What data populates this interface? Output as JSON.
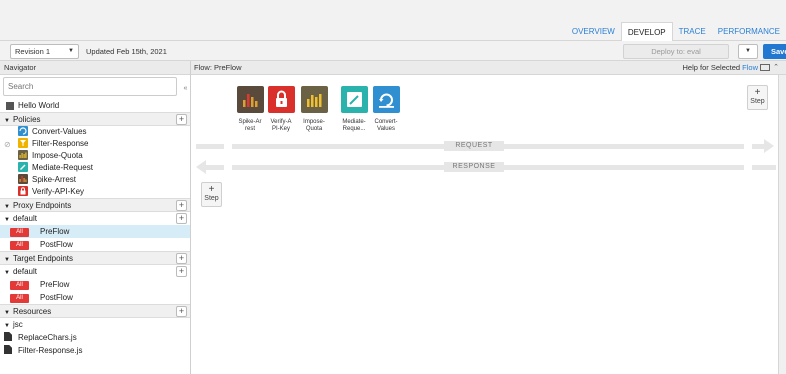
{
  "tabs": [
    {
      "label": "OVERVIEW",
      "active": false
    },
    {
      "label": "DEVELOP",
      "active": true
    },
    {
      "label": "TRACE",
      "active": false
    },
    {
      "label": "PERFORMANCE",
      "active": false
    }
  ],
  "revision": {
    "selected": "Revision 1",
    "updated": "Updated Feb 15th, 2021"
  },
  "deploy": {
    "placeholder": "Deploy to: eval",
    "save_label": "Save"
  },
  "navigator": {
    "title": "Navigator",
    "collapse": "«",
    "search_placeholder": "Search",
    "root_item": "Hello World",
    "policies_label": "Policies",
    "policies": [
      {
        "name": "Convert-Values",
        "icon": "convert-icon",
        "color": "#2f8fd0"
      },
      {
        "name": "Filter-Response",
        "icon": "filter-icon",
        "color": "#f0b400"
      },
      {
        "name": "Impose-Quota",
        "icon": "quota-icon",
        "color": "#6b6246"
      },
      {
        "name": "Mediate-Request",
        "icon": "mediate-icon",
        "color": "#2ab3ad"
      },
      {
        "name": "Spike-Arrest",
        "icon": "spike-icon",
        "color": "#5a4a3b"
      },
      {
        "name": "Verify-API-Key",
        "icon": "lock-icon",
        "color": "#d9302c"
      }
    ],
    "proxy_endpoints_label": "Proxy Endpoints",
    "proxy_default": "default",
    "proxy_flows": [
      {
        "badge": "All",
        "name": "PreFlow",
        "selected": true
      },
      {
        "badge": "All",
        "name": "PostFlow",
        "selected": false
      }
    ],
    "target_endpoints_label": "Target Endpoints",
    "target_default": "default",
    "target_flows": [
      {
        "badge": "All",
        "name": "PreFlow"
      },
      {
        "badge": "All",
        "name": "PostFlow"
      }
    ],
    "resources_label": "Resources",
    "resource_folder": "jsc",
    "resources": [
      "ReplaceChars.js",
      "Filter-Response.js"
    ]
  },
  "flow": {
    "title": "Flow: PreFlow",
    "help_prefix": "Help for Selected",
    "help_link": "Flow",
    "policies": [
      {
        "line1": "Spike-Ar",
        "line2": "rest",
        "icon": "spike-icon",
        "color": "#5a4a3b"
      },
      {
        "line1": "Verify-A",
        "line2": "PI-Key",
        "icon": "lock-icon",
        "color": "#d9302c"
      },
      {
        "line1": "Impose-",
        "line2": "Quota",
        "icon": "quota-icon",
        "color": "#6b6246"
      },
      {
        "line1": "Mediate-",
        "line2": "Reque...",
        "icon": "mediate-icon",
        "color": "#2ab3ad"
      },
      {
        "line1": "Convert-",
        "line2": "Values",
        "icon": "convert-icon",
        "color": "#2f8fd0"
      }
    ],
    "request_label": "REQUEST",
    "response_label": "RESPONSE",
    "step_plus": "+",
    "step_label": "Step"
  }
}
